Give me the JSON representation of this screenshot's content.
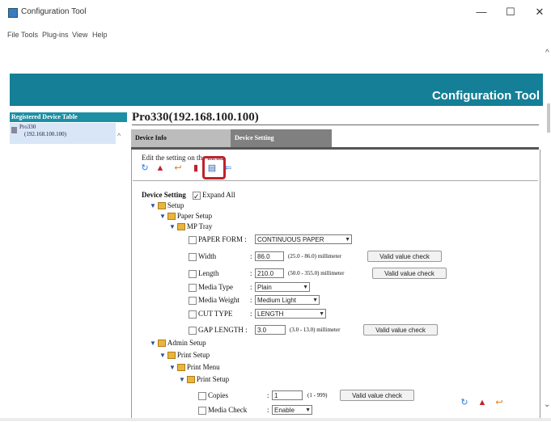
{
  "window": {
    "title": "Configuration Tool",
    "controls": {
      "minimize": "—",
      "maximize": "☐",
      "close": "✕"
    }
  },
  "menu": [
    "File",
    "Tools",
    "Plug-ins",
    "View",
    "Help"
  ],
  "banner": {
    "title": "Configuration Tool"
  },
  "left_panel": {
    "header": "Registered Device Table",
    "device": {
      "name": "Pro330",
      "ip": "(192.168.100.100)"
    }
  },
  "main": {
    "device_title": "Pro330(192.168.100.100)",
    "tabs": [
      {
        "label": "Device Info"
      },
      {
        "label": "Device Setting"
      }
    ],
    "edit_message": "Edit the setting on the menu.",
    "toolbar_icons": [
      "refresh-icon",
      "printer-icon",
      "undo-icon",
      "clipboard-icon",
      "document-icon",
      "arrow-left-icon"
    ],
    "setting_label": "Device Setting",
    "expand_all": "Expand All",
    "tree": {
      "setup": "Setup",
      "paper_setup": "Paper Setup",
      "mp_tray": "MP Tray",
      "admin_setup": "Admin Setup",
      "print_setup": "Print Setup",
      "print_menu": "Print Menu",
      "print_setup2": "Print Setup"
    },
    "settings": {
      "paper_form": {
        "label": "PAPER FORM",
        "value": "CONTINUOUS PAPER"
      },
      "width": {
        "label": "Width",
        "value": "86.0",
        "range": "(25.0 - 86.0) millimeter",
        "button": "Valid value check"
      },
      "length": {
        "label": "Length",
        "value": "210.0",
        "range": "(50.0 - 355.0) millimeter",
        "button": "Valid value check"
      },
      "media_type": {
        "label": "Media Type",
        "value": "Plain"
      },
      "media_weight": {
        "label": "Media Weight",
        "value": "Medium Light"
      },
      "cut_type": {
        "label": "CUT TYPE",
        "value": "LENGTH"
      },
      "gap_length": {
        "label": "GAP LENGTH",
        "value": "3.0",
        "range": "(3.0 - 13.0) millimeter",
        "button": "Valid value check"
      },
      "copies": {
        "label": "Copies",
        "value": "1",
        "range": "(1 - 999)",
        "button": "Valid value check"
      },
      "media_check": {
        "label": "Media Check",
        "value": "Enable"
      }
    },
    "bottom_icons": [
      "refresh-icon",
      "printer-icon",
      "undo-icon"
    ]
  },
  "colors": {
    "banner": "#147f96",
    "highlight": "#c0232c",
    "tab_active": "#808080"
  }
}
